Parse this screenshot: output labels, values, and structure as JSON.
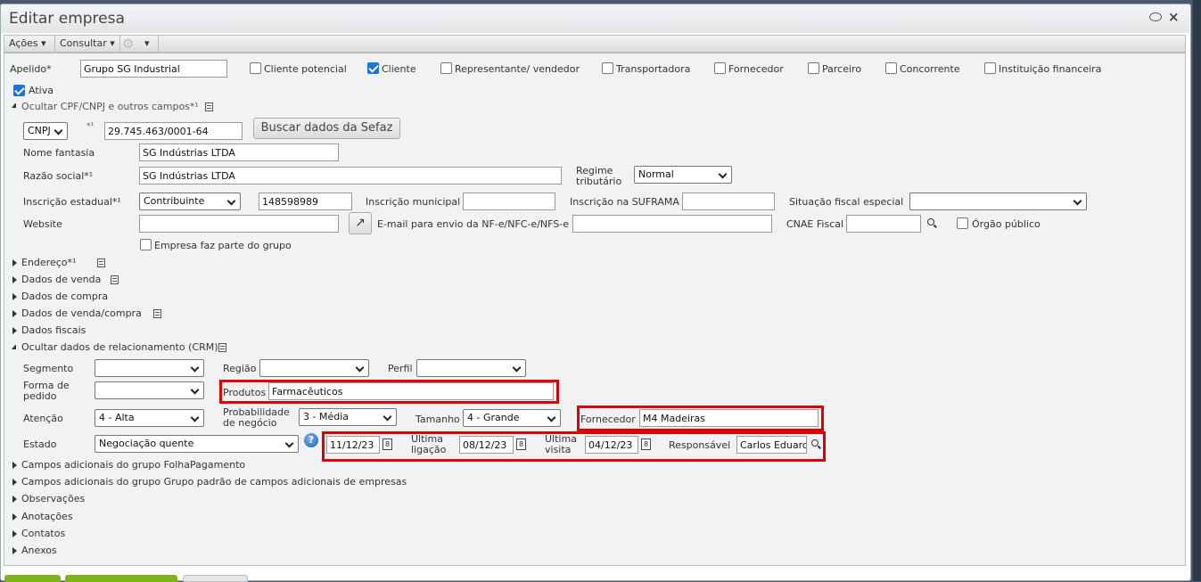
{
  "window": {
    "title": "Editar empresa"
  },
  "toolbar": {
    "actions": "Ações",
    "consult": "Consultar"
  },
  "main": {
    "apelido_label": "Apelido*",
    "apelido_value": "Grupo SG Industrial",
    "types": [
      {
        "label": "Cliente potencial",
        "checked": false
      },
      {
        "label": "Cliente",
        "checked": true
      },
      {
        "label": "Representante/ vendedor",
        "checked": false
      },
      {
        "label": "Transportadora",
        "checked": false
      },
      {
        "label": "Fornecedor",
        "checked": false
      },
      {
        "label": "Parceiro",
        "checked": false
      },
      {
        "label": "Concorrente",
        "checked": false
      },
      {
        "label": "Instituição financeira",
        "checked": false
      }
    ],
    "ativa_label": "Ativa",
    "ativa_checked": true,
    "cpf_section": "Ocultar CPF/CNPJ e outros campos*¹",
    "doc_type": "CNPJ",
    "doc_marker": "*¹",
    "doc_value": "29.745.463/0001-64",
    "sefaz_button": "Buscar dados da Sefaz",
    "nome_fantasia_label": "Nome fantasia",
    "nome_fantasia": "SG Indústrias LTDA",
    "razao_label": "Razão social*¹",
    "razao": "SG Indústrias LTDA",
    "regime_label": "Regime tributário",
    "regime": "Normal",
    "ie_label": "Inscrição estadual*¹",
    "ie_type": "Contribuinte",
    "ie_value": "148598989",
    "im_label": "Inscrição municipal",
    "im_value": "",
    "suframa_label": "Inscrição na SUFRAMA",
    "suframa_value": "",
    "situacao_label": "Situação fiscal especial",
    "situacao_value": "",
    "website_label": "Website",
    "website_value": "",
    "email_label": "E-mail para envio da NF-e/NFC-e/NFS-e",
    "email_value": "",
    "cnae_label": "CNAE Fiscal",
    "cnae_value": "",
    "orgao_label": "Órgão público",
    "orgao_checked": false,
    "grupo_label": "Empresa faz parte do grupo",
    "grupo_checked": false,
    "sections_mid": [
      {
        "label": "Endereço*¹",
        "doc": true
      },
      {
        "label": "Dados de venda",
        "doc": true
      },
      {
        "label": "Dados de compra",
        "doc": false
      },
      {
        "label": "Dados de venda/compra",
        "doc": true
      },
      {
        "label": "Dados fiscais",
        "doc": false
      }
    ],
    "crm_section": "Ocultar dados de relacionamento (CRM)",
    "crm": {
      "segmento_label": "Segmento",
      "segmento": "",
      "regiao_label": "Região",
      "regiao": "",
      "perfil_label": "Perfil",
      "perfil": "",
      "forma_label": "Forma de pedido",
      "forma": "",
      "produtos_label": "Produtos",
      "produtos": "Farmacêuticos",
      "atencao_label": "Atenção",
      "atencao": "4 - Alta",
      "prob_label": "Probabilidade de negócio",
      "prob": "3 - Média",
      "tamanho_label": "Tamanho",
      "tamanho": "4 - Grande",
      "fornecedor_label": "Fornecedor atual",
      "fornecedor": "M4 Madeiras",
      "estado_label": "Estado",
      "estado": "Negociação quente",
      "date1": "11/12/23",
      "ultima_ligacao_label": "Última ligação",
      "ultima_ligacao": "08/12/23",
      "ultima_visita_label": "Última visita",
      "ultima_visita": "04/12/23",
      "responsavel_label": "Responsável",
      "responsavel": "Carlos Eduard",
      "cal_glyph": "8"
    },
    "sections_bottom": [
      "Campos adicionais do grupo FolhaPagamento",
      "Campos adicionais do grupo Grupo padrão de campos adicionais de empresas",
      "Observações",
      "Anotações",
      "Contatos",
      "Anexos"
    ]
  },
  "colors": {
    "highlight": "#e00000",
    "checkbox": "#1a73e8",
    "button_green": "#7cb518"
  }
}
